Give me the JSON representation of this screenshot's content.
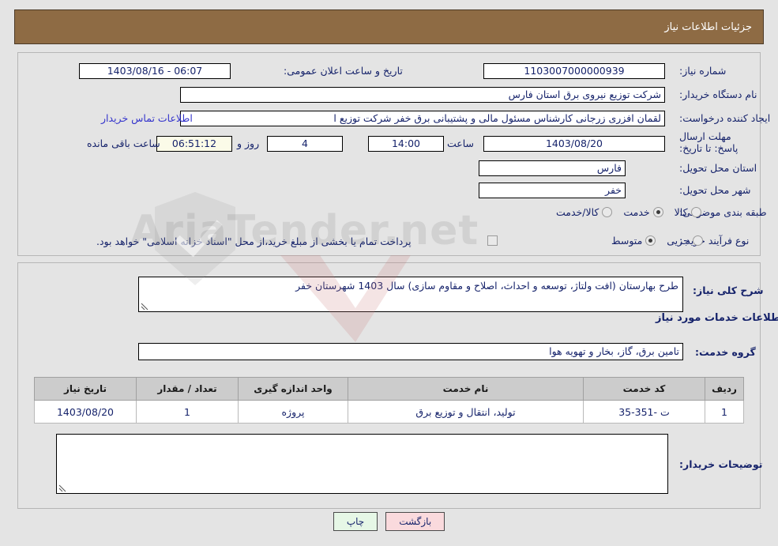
{
  "header": {
    "title": "جزئیات اطلاعات نیاز"
  },
  "watermark": {
    "text": "AriaTender.net"
  },
  "form": {
    "need_number": {
      "label": "شماره نیاز:",
      "value": "1103007000000939"
    },
    "public_announce": {
      "label": "تاریخ و ساعت اعلان عمومی:",
      "value": "06:07 - 1403/08/16"
    },
    "buyer_org": {
      "label": "نام دستگاه خریدار:",
      "value": "شرکت توزیع نیروی برق استان فارس"
    },
    "request_creator": {
      "label": "ایجاد کننده درخواست:",
      "value": "لقمان افزری زرجانی کارشناس مسئول مالی و پشتیبانی برق خفر شرکت توزیع ا",
      "contact_link": "اطلاعات تماس خریدار"
    },
    "deadline": {
      "label": "مهلت ارسال پاسخ: تا تاریخ:",
      "date": "1403/08/20",
      "hour_label": "ساعت",
      "time": "14:00",
      "days": "4",
      "days_label": "روز و",
      "countdown": "06:51:12",
      "remaining_label": "ساعت باقی مانده"
    },
    "delivery_province": {
      "label": "استان محل تحویل:",
      "value": "فارس"
    },
    "delivery_city": {
      "label": "شهر محل تحویل:",
      "value": "خفر"
    },
    "subject_category": {
      "label": "طبقه بندی موضوعی:",
      "options": [
        {
          "label": "کالا",
          "selected": false
        },
        {
          "label": "خدمت",
          "selected": true
        },
        {
          "label": "کالا/خدمت",
          "selected": false
        }
      ]
    },
    "purchase_process": {
      "label": "نوع فرآیند خرید :",
      "options": [
        {
          "label": "جزیی",
          "selected": false
        },
        {
          "label": "متوسط",
          "selected": true
        }
      ],
      "treasury_note": "پرداخت تمام یا بخشی از مبلغ خرید،از محل \"اسناد خزانه اسلامی\" خواهد بود."
    }
  },
  "description": {
    "label": "شرح کلی نیاز:",
    "value": "طرح بهارستان (افت ولتاژ، توسعه و احداث، اصلاح و مقاوم سازی) سال 1403 شهرستان خفر"
  },
  "services_section": {
    "heading": "اطلاعات خدمات مورد نیاز",
    "group_label": "گروه خدمت:",
    "group_value": "تامین برق، گاز، بخار و تهویه هوا"
  },
  "table": {
    "columns": [
      "ردیف",
      "کد خدمت",
      "نام خدمت",
      "واحد اندازه گیری",
      "تعداد / مقدار",
      "تاریخ نیاز"
    ],
    "rows": [
      {
        "row_no": "1",
        "service_code": "ت -351-35",
        "service_name": "تولید، انتقال و توزیع برق",
        "unit": "پروژه",
        "quantity": "1",
        "need_date": "1403/08/20"
      }
    ]
  },
  "buyer_notes": {
    "label": "توضیحات خریدار:",
    "value": ""
  },
  "buttons": {
    "print": "چاپ",
    "back": "بازگشت"
  },
  "colors": {
    "header_bg": "#8e6b44",
    "page_bg": "#e4e4e4",
    "text": "#16236b",
    "link": "#3333cc",
    "countdown_bg": "#fbfbe8",
    "table_header_bg": "#cccccc",
    "print_btn_bg": "#e6f7e6",
    "back_btn_bg": "#fadadd"
  }
}
